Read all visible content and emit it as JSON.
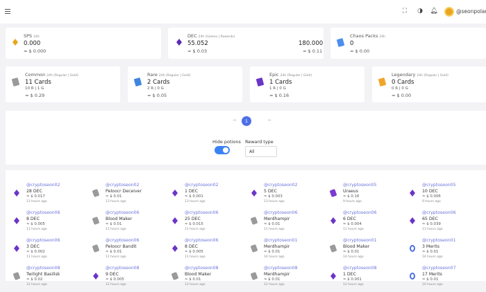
{
  "header": {
    "username": "@seonpolane"
  },
  "stats": [
    {
      "key": "sps",
      "title": "SPS",
      "sub": "24h",
      "value": "0.000",
      "usd": "≈ $ 0.000",
      "icon": "sps-icon",
      "color": "#e8a51c"
    },
    {
      "key": "dec",
      "title": "DEC",
      "sub": "24h (Games | Rewards)",
      "value": "55.052",
      "value2": "180.000",
      "usd": "≈ $ 0.03",
      "usd2": "≈ $ 0.11",
      "icon": "dec-icon",
      "color": "#5b2bb5"
    },
    {
      "key": "chaos",
      "title": "Chaos Packs",
      "sub": "24h",
      "value": "0",
      "usd": "≈ $ 0.00",
      "icon": "chaos-pack-icon",
      "color": "#4b8ef0"
    }
  ],
  "rarities": [
    {
      "title": "Common",
      "sub": "24h (Regular | Gold)",
      "value": "11 Cards",
      "counts": "10 R | 1 G",
      "usd": "≈ $ 0.29",
      "color": "#9a9a9a"
    },
    {
      "title": "Rare",
      "sub": "24h (Regular | Gold)",
      "value": "2 Cards",
      "counts": "2 R | 0 G",
      "usd": "≈ $ 0.05",
      "color": "#3f86e0"
    },
    {
      "title": "Epic",
      "sub": "24h (Regular | Gold)",
      "value": "1 Cards",
      "counts": "1 R | 0 G",
      "usd": "≈ $ 0.16",
      "color": "#6a35c8"
    },
    {
      "title": "Legendary",
      "sub": "24h (Regular | Gold)",
      "value": "0 Cards",
      "counts": "0 R | 0 G",
      "usd": "≈ $ 0.00",
      "color": "#f0a52a"
    }
  ],
  "pagination": {
    "current": "1"
  },
  "filters": {
    "hide_potions": "Hide potions",
    "reward_type": "Reward type",
    "reward_value": "All"
  },
  "feed": [
    {
      "u": "@cryptoseon02",
      "d": "28 DEC",
      "s": "≈ $ 0.017",
      "t": "13 hours ago",
      "i": "dia"
    },
    {
      "u": "@cryptoseon02",
      "d": "Peloocr Deceiver",
      "s": "≈ $ 0.01",
      "t": "13 hours ago",
      "i": "pot"
    },
    {
      "u": "@cryptoseon02",
      "d": "1 DEC",
      "s": "≈ $ 0.001",
      "t": "13 hours ago",
      "i": "dia"
    },
    {
      "u": "@cryptoseon02",
      "d": "5 DEC",
      "s": "≈ $ 0.003",
      "t": "13 hours ago",
      "i": "dia"
    },
    {
      "u": "@cryptoseon05",
      "d": "Uraeus",
      "s": "≈ $ 0.16",
      "t": "9 hours ago",
      "i": "pot2"
    },
    {
      "u": "@cryptoseon05",
      "d": "10 DEC",
      "s": "≈ $ 0.006",
      "t": "9 hours ago",
      "i": "dia"
    },
    {
      "u": "@cryptoseon06",
      "d": "8 DEC",
      "s": "≈ $ 0.005",
      "t": "11 hours ago",
      "i": "dia"
    },
    {
      "u": "@cryptoseon06",
      "d": "Blood Maker",
      "s": "≈ $ 0.01",
      "t": "11 hours ago",
      "i": "pot"
    },
    {
      "u": "@cryptoseon06",
      "d": "25 DEC",
      "s": "≈ $ 0.015",
      "t": "11 hours ago",
      "i": "dia"
    },
    {
      "u": "@cryptoseon06",
      "d": "Merdhampir",
      "s": "≈ $ 0.01",
      "t": "11 hours ago",
      "i": "pot"
    },
    {
      "u": "@cryptoseon06",
      "d": "6 DEC",
      "s": "≈ $ 0.004",
      "t": "11 hours ago",
      "i": "dia"
    },
    {
      "u": "@cryptoseon06",
      "d": "65 DEC",
      "s": "≈ $ 0.039",
      "t": "11 hours ago",
      "i": "dia"
    },
    {
      "u": "@cryptoseon06",
      "d": "3 DEC",
      "s": "≈ $ 0.002",
      "t": "11 hours ago",
      "i": "dia"
    },
    {
      "u": "@cryptoseon06",
      "d": "Peloocr Bandit",
      "s": "≈ $ 0.01",
      "t": "11 hours ago",
      "i": "pot"
    },
    {
      "u": "@cryptoseon06",
      "d": "8 DEC",
      "s": "≈ $ 0.005",
      "t": "11 hours ago",
      "i": "dia"
    },
    {
      "u": "@cryptoseon01",
      "d": "Merdhampir",
      "s": "≈ $ 0.01",
      "t": "14 hours ago",
      "i": "pot"
    },
    {
      "u": "@cryptoseon01",
      "d": "Blood Maker",
      "s": "≈ $ 0.01",
      "t": "14 hours ago",
      "i": "pot"
    },
    {
      "u": "@cryptoseon01",
      "d": "3 Merits",
      "s": "≈ $ 0.01",
      "t": "14 hours ago",
      "i": "mer"
    },
    {
      "u": "@cryptoseon08",
      "d": "Twilight Basilisk",
      "s": "≈ $ 0.02",
      "t": "12 hours ago",
      "i": "pot"
    },
    {
      "u": "@cryptoseon08",
      "d": "9 DEC",
      "s": "≈ $ 0.005",
      "t": "12 hours ago",
      "i": "dia"
    },
    {
      "u": "@cryptoseon08",
      "d": "Blood Maker",
      "s": "≈ $ 0.01",
      "t": "12 hours ago",
      "i": "pot"
    },
    {
      "u": "@cryptoseon08",
      "d": "Merdhampir",
      "s": "≈ $ 0.01",
      "t": "12 hours ago",
      "i": "pot"
    },
    {
      "u": "@cryptoseon08",
      "d": "1 DEC",
      "s": "≈ $ 0.001",
      "t": "12 hours ago",
      "i": "dia"
    },
    {
      "u": "@cryptoseon07",
      "d": "17 Merits",
      "s": "≈ $ 0.01",
      "t": "10 hours ago",
      "i": "mer"
    }
  ]
}
